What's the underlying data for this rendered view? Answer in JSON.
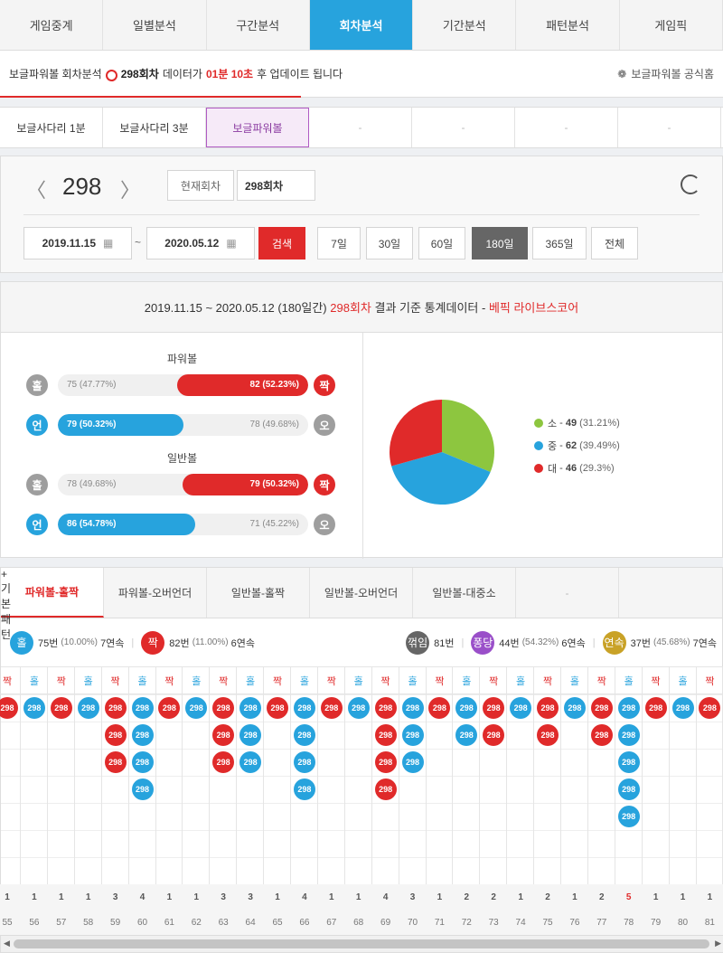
{
  "topnav": [
    "게임중계",
    "일별분석",
    "구간분석",
    "회차분석",
    "기간분석",
    "패턴분석",
    "게임픽"
  ],
  "topnav_active": 3,
  "info": {
    "prefix": "보글파워볼 회차분석",
    "round": "298회차",
    "middle": "데이터가",
    "time": "01분 10초",
    "suffix": "후 업데이트 됩니다",
    "official": "보글파워볼 공식홈"
  },
  "gametabs": [
    "보글사다리 1분",
    "보글사다리 3분",
    "보글파워볼",
    "-",
    "-",
    "-",
    "-"
  ],
  "gametabs_active": 2,
  "control": {
    "prev": "〈",
    "next": "〉",
    "round": "298",
    "current_btn": "현재회차",
    "round_input": "298회차",
    "date_from": "2019.11.15",
    "tilde": "~",
    "date_to": "2020.05.12",
    "search": "검색",
    "periods": [
      "7일",
      "30일",
      "60일",
      "180일",
      "365일",
      "전체"
    ],
    "period_active": 3
  },
  "stats": {
    "head_range": "2019.11.15 ~ 2020.05.12 (180일간)",
    "head_round": "298회차",
    "head_mid": "결과 기준 통계데이터 -",
    "head_source": "베픽 라이브스코어",
    "powerball_title": "파워볼",
    "normalball_title": "일반볼",
    "rows": [
      {
        "left_label": "홀",
        "left_text": "75 (47.77%)",
        "right_text": "82 (52.23%)",
        "right_label": "짝",
        "fill_side": "right",
        "fill_pct": 52.23,
        "left_color": "gray",
        "right_color": "red"
      },
      {
        "left_label": "언",
        "left_text": "79 (50.32%)",
        "right_text": "78 (49.68%)",
        "right_label": "오",
        "fill_side": "left",
        "fill_pct": 50.32,
        "left_color": "blue",
        "right_color": "gray"
      },
      {
        "left_label": "홀",
        "left_text": "78 (49.68%)",
        "right_text": "79 (50.32%)",
        "right_label": "짝",
        "fill_side": "right",
        "fill_pct": 50.32,
        "left_color": "gray",
        "right_color": "red"
      },
      {
        "left_label": "언",
        "left_text": "86 (54.78%)",
        "right_text": "71 (45.22%)",
        "right_label": "오",
        "fill_side": "left",
        "fill_pct": 54.78,
        "left_color": "blue",
        "right_color": "gray"
      }
    ],
    "pie_legend": [
      {
        "label": "소",
        "count": "49",
        "pct": "(31.21%)",
        "color": "#8dc63f",
        "value": 31.21
      },
      {
        "label": "중",
        "count": "62",
        "pct": "(39.49%)",
        "color": "#27a3dd",
        "value": 39.49
      },
      {
        "label": "대",
        "count": "46",
        "pct": "(29.3%)",
        "color": "#e02a2a",
        "value": 29.3
      }
    ],
    "legend_sep": " - "
  },
  "pattern": {
    "tabs": [
      "파워볼-홀짝",
      "파워볼-오버언더",
      "일반볼-홀짝",
      "일반볼-오버언더",
      "일반볼-대중소",
      "-"
    ],
    "tab_active": 0,
    "basic_btn": "+ 기본패턴",
    "summary": {
      "odd_label": "홀",
      "odd_count": "75번",
      "odd_pct": "(10.00%)",
      "odd_streak": "7연속",
      "even_label": "짝",
      "even_count": "82번",
      "even_pct": "(11.00%)",
      "even_streak": "6연속",
      "break_label": "꺾임",
      "break_count": "81번",
      "pong_label": "퐁당",
      "pong_count": "44번",
      "pong_pct": "(54.32%)",
      "pong_streak": "6연속",
      "cont_label": "연속",
      "cont_count": "37번",
      "cont_pct": "(45.68%)",
      "cont_streak": "7연속"
    },
    "ball_label": "298",
    "columns": [
      {
        "h": "짝",
        "n": 1,
        "c": "1",
        "r": "55"
      },
      {
        "h": "홀",
        "n": 1,
        "c": "1",
        "r": "56"
      },
      {
        "h": "짝",
        "n": 1,
        "c": "1",
        "r": "57"
      },
      {
        "h": "홀",
        "n": 1,
        "c": "1",
        "r": "58"
      },
      {
        "h": "짝",
        "n": 3,
        "c": "3",
        "r": "59"
      },
      {
        "h": "홀",
        "n": 4,
        "c": "4",
        "r": "60"
      },
      {
        "h": "짝",
        "n": 1,
        "c": "1",
        "r": "61"
      },
      {
        "h": "홀",
        "n": 1,
        "c": "1",
        "r": "62"
      },
      {
        "h": "짝",
        "n": 3,
        "c": "3",
        "r": "63"
      },
      {
        "h": "홀",
        "n": 3,
        "c": "3",
        "r": "64"
      },
      {
        "h": "짝",
        "n": 1,
        "c": "1",
        "r": "65"
      },
      {
        "h": "홀",
        "n": 4,
        "c": "4",
        "r": "66"
      },
      {
        "h": "짝",
        "n": 1,
        "c": "1",
        "r": "67"
      },
      {
        "h": "홀",
        "n": 1,
        "c": "1",
        "r": "68"
      },
      {
        "h": "짝",
        "n": 4,
        "c": "4",
        "r": "69"
      },
      {
        "h": "홀",
        "n": 3,
        "c": "3",
        "r": "70"
      },
      {
        "h": "짝",
        "n": 1,
        "c": "1",
        "r": "71"
      },
      {
        "h": "홀",
        "n": 2,
        "c": "2",
        "r": "72"
      },
      {
        "h": "짝",
        "n": 2,
        "c": "2",
        "r": "73"
      },
      {
        "h": "홀",
        "n": 1,
        "c": "1",
        "r": "74"
      },
      {
        "h": "짝",
        "n": 2,
        "c": "2",
        "r": "75"
      },
      {
        "h": "홀",
        "n": 1,
        "c": "1",
        "r": "76"
      },
      {
        "h": "짝",
        "n": 2,
        "c": "2",
        "r": "77"
      },
      {
        "h": "홀",
        "n": 5,
        "c": "5",
        "r": "78",
        "hi": true
      },
      {
        "h": "짝",
        "n": 1,
        "c": "1",
        "r": "79"
      },
      {
        "h": "홀",
        "n": 1,
        "c": "1",
        "r": "80"
      },
      {
        "h": "짝",
        "n": 1,
        "c": "1",
        "r": "81"
      }
    ]
  }
}
